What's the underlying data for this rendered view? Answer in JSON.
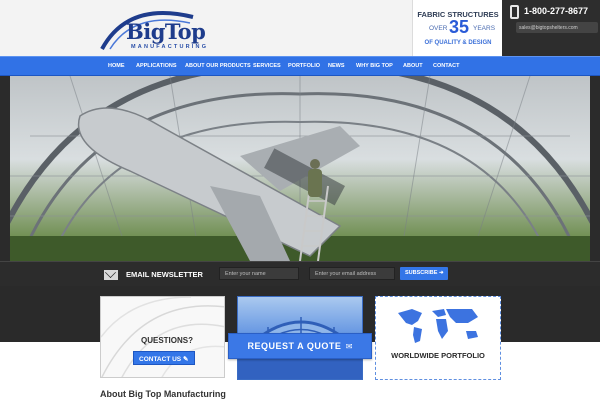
{
  "header": {
    "logo": {
      "name": "BigTop",
      "subtitle": "MANUFACTURING"
    },
    "promo": {
      "line1": "FABRIC STRUCTURES",
      "over": "OVER",
      "number": "35",
      "years": "YEARS",
      "line3": "OF QUALITY & DESIGN"
    },
    "contact": {
      "phone": "1-800-277-8677",
      "email": "sales@bigtopshelters.com"
    }
  },
  "nav": {
    "items": [
      {
        "label": "HOME"
      },
      {
        "label": "APPLICATIONS"
      },
      {
        "label": "ABOUT OUR PRODUCTS"
      },
      {
        "label": "SERVICES"
      },
      {
        "label": "PORTFOLIO"
      },
      {
        "label": "NEWS"
      },
      {
        "label": "WHY BIG TOP"
      },
      {
        "label": "ABOUT"
      },
      {
        "label": "CONTACT"
      }
    ]
  },
  "newsletter": {
    "title": "EMAIL NEWSLETTER",
    "name_placeholder": "Enter your name",
    "email_placeholder": "Enter your email address",
    "subscribe_label": "SUBSCRIBE"
  },
  "cards": {
    "questions": {
      "title": "QUESTIONS?",
      "button_label": "CONTACT US"
    },
    "quote": {
      "label": "REQUEST A QUOTE"
    },
    "portfolio": {
      "title": "WORLDWIDE PORTFOLIO"
    }
  },
  "about": {
    "title": "About Big Top Manufacturing"
  },
  "colors": {
    "accent": "#3376e8",
    "dark": "#2c2c2c",
    "brand_navy": "#1e3c8c"
  }
}
